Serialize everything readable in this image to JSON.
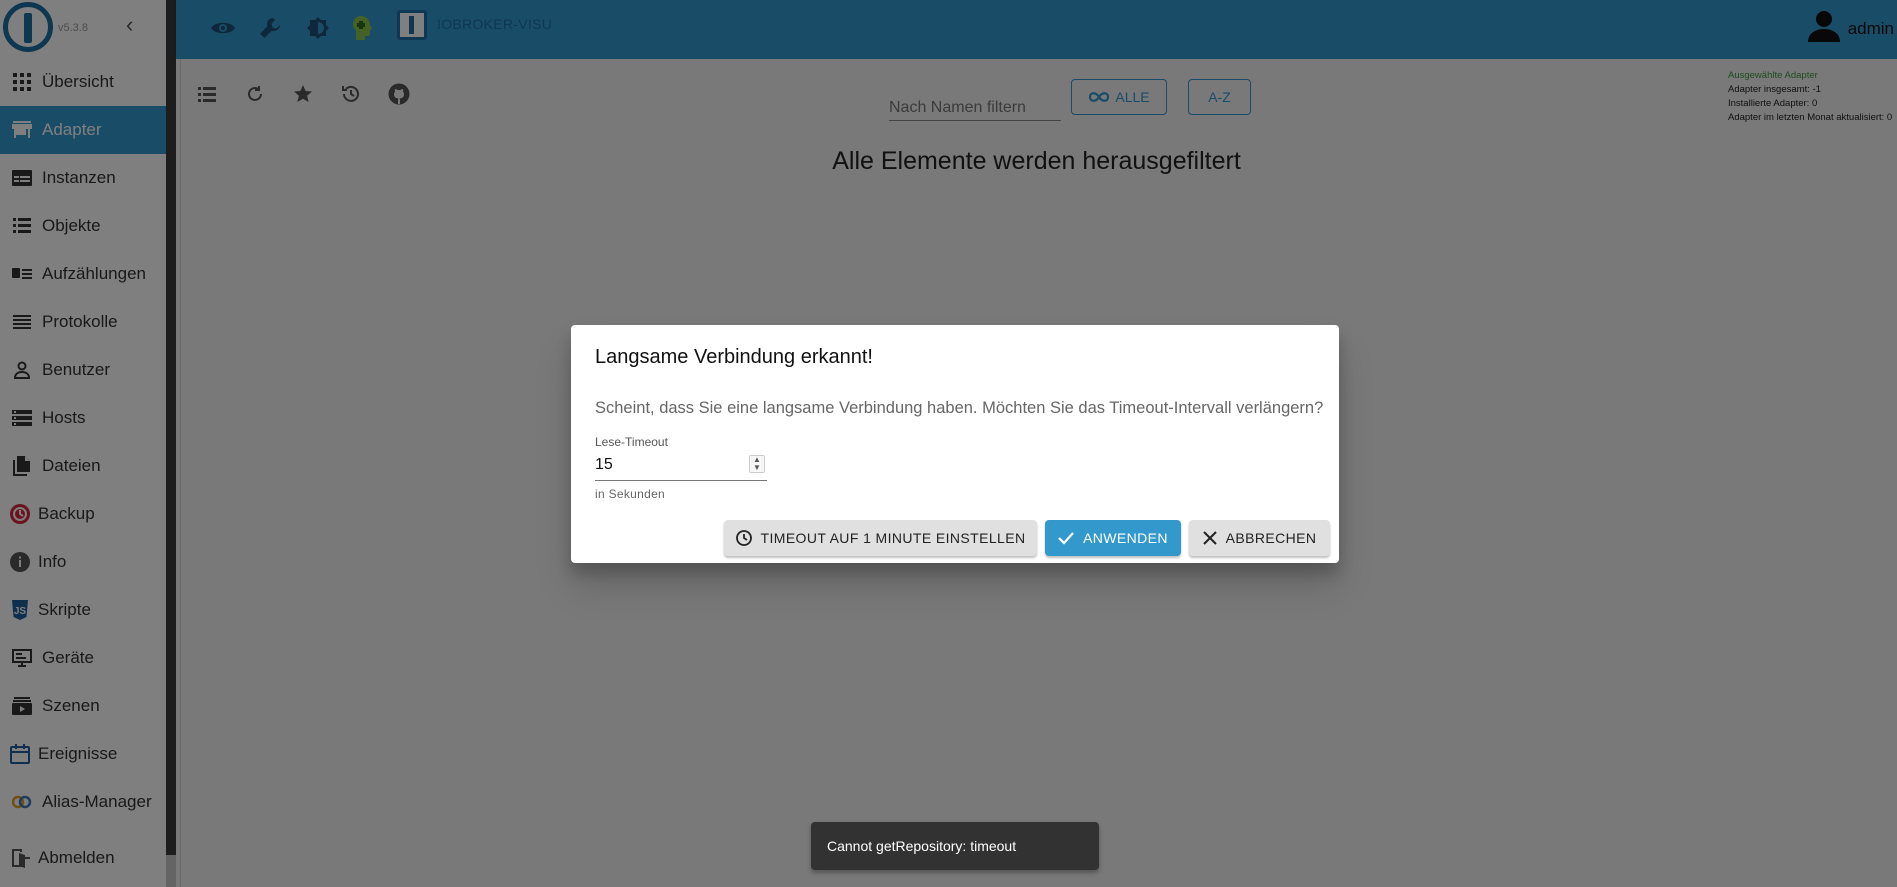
{
  "sidebar": {
    "version": "v5.3.8",
    "items": [
      {
        "label": "Übersicht",
        "icon": "grid-icon"
      },
      {
        "label": "Adapter",
        "icon": "store-icon"
      },
      {
        "label": "Instanzen",
        "icon": "instances-icon"
      },
      {
        "label": "Objekte",
        "icon": "list-icon"
      },
      {
        "label": "Aufzählungen",
        "icon": "enums-icon"
      },
      {
        "label": "Protokolle",
        "icon": "logs-icon"
      },
      {
        "label": "Benutzer",
        "icon": "person-icon"
      },
      {
        "label": "Hosts",
        "icon": "hosts-icon"
      },
      {
        "label": "Dateien",
        "icon": "files-icon"
      },
      {
        "label": "Backup",
        "icon": "backup-icon"
      },
      {
        "label": "Info",
        "icon": "info-icon"
      },
      {
        "label": "Skripte",
        "icon": "javascript-icon"
      },
      {
        "label": "Geräte",
        "icon": "devices-icon"
      },
      {
        "label": "Szenen",
        "icon": "scenes-icon"
      },
      {
        "label": "Ereignisse",
        "icon": "calendar-icon"
      },
      {
        "label": "Alias-Manager",
        "icon": "alias-icon"
      },
      {
        "label": "Abmelden",
        "icon": "logout-icon"
      }
    ],
    "active_index": 1
  },
  "header": {
    "app_name": "IOBROKER-VISU",
    "user": "admin",
    "icons": [
      "eye-icon",
      "wrench-icon",
      "theme-icon",
      "expert-mode-icon"
    ]
  },
  "main": {
    "toolbar_icons": [
      "list-view-icon",
      "refresh-icon",
      "star-icon",
      "update-icon",
      "github-icon"
    ],
    "filter_placeholder": "Nach Namen filtern",
    "btn_all": "ALLE",
    "btn_az": "A-Z",
    "empty_message": "Alle Elemente werden herausgefiltert",
    "stats": {
      "selected": "Ausgewählte Adapter",
      "total": "Adapter insgesamt: -1",
      "installed": "Installierte Adapter: 0",
      "updated": "Adapter im letzten Monat aktualisiert: 0"
    }
  },
  "dialog": {
    "title": "Langsame Verbindung erkannt!",
    "text": "Scheint, dass Sie eine langsame Verbindung haben. Möchten Sie das Timeout-Intervall verlängern?",
    "field_label": "Lese-Timeout",
    "field_value": "15",
    "helper": "in Sekunden",
    "btn_timeout": "TIMEOUT AUF 1 MINUTE EINSTELLEN",
    "btn_apply": "ANWENDEN",
    "btn_cancel": "ABBRECHEN"
  },
  "snackbar": {
    "message": "Cannot getRepository: timeout"
  },
  "colors": {
    "accent": "#3399cc",
    "brand_dark": "#1d6ea5",
    "snackbar": "#323232"
  }
}
